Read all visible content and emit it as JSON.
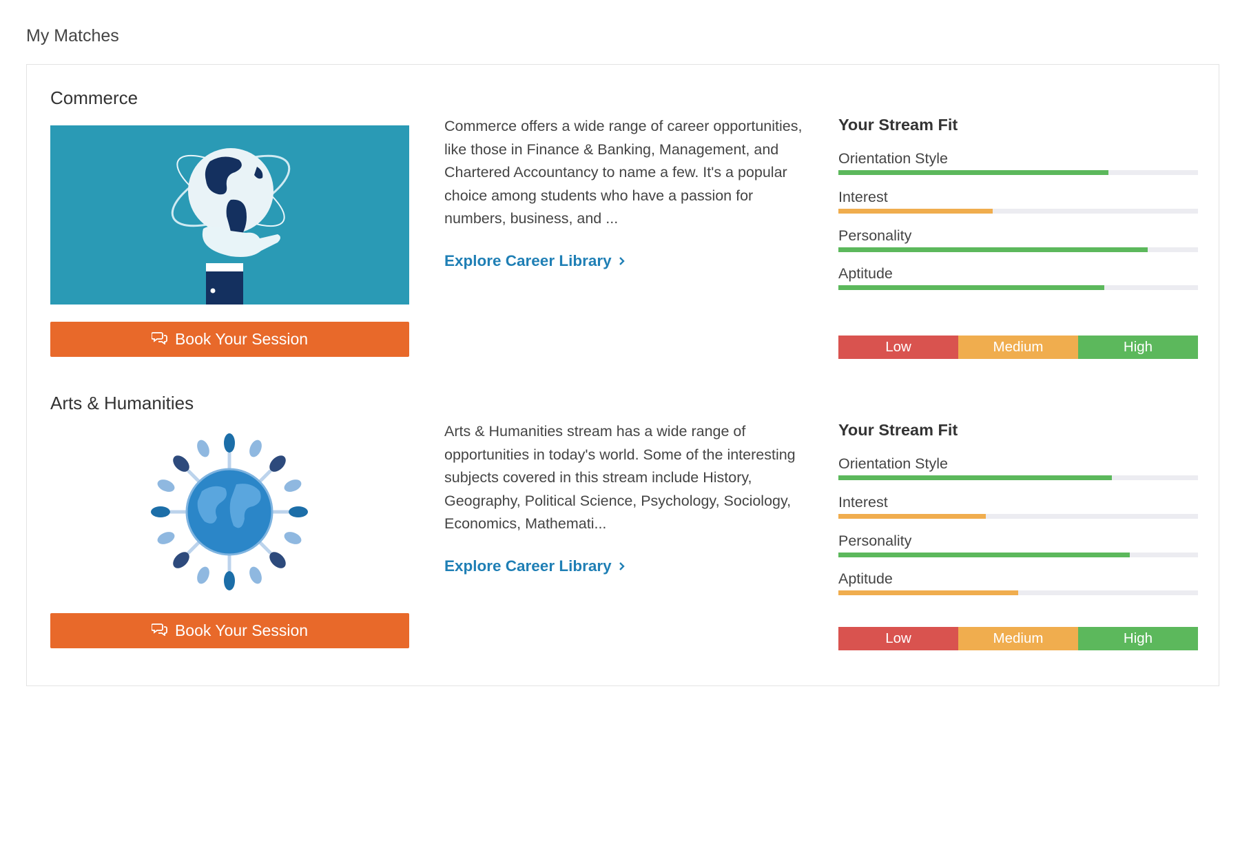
{
  "page_title": "My Matches",
  "colors": {
    "accent_button": "#e8692a",
    "link": "#1f7fb5",
    "fit_high": "#5cb85c",
    "fit_medium": "#f0ad4e",
    "fit_low": "#d9534f"
  },
  "streams": [
    {
      "name": "Commerce",
      "image_icon": "globe-in-hand-illustration",
      "description": "Commerce offers a wide range of career opportunities, like those in Finance & Banking, Management, and Chartered Accountancy to name a few. It's a popular choice among students who have a passion for numbers, business, and ...",
      "explore_label": "Explore Career Library",
      "book_label": "Book Your Session",
      "fit_title": "Your Stream Fit",
      "fit": [
        {
          "label": "Orientation Style",
          "fraction": 0.75,
          "level": "high"
        },
        {
          "label": "Interest",
          "fraction": 0.43,
          "level": "medium"
        },
        {
          "label": "Personality",
          "fraction": 0.86,
          "level": "high"
        },
        {
          "label": "Aptitude",
          "fraction": 0.74,
          "level": "high"
        }
      ],
      "legend": [
        "Low",
        "Medium",
        "High"
      ]
    },
    {
      "name": "Arts & Humanities",
      "image_icon": "globe-with-hands-illustration",
      "description": "Arts & Humanities stream has a wide range of opportunities in today's world. Some of the interesting subjects covered in this stream include History, Geography, Political Science, Psychology, Sociology, Economics, Mathemati...",
      "explore_label": "Explore Career Library",
      "book_label": "Book Your Session",
      "fit_title": "Your Stream Fit",
      "fit": [
        {
          "label": "Orientation Style",
          "fraction": 0.76,
          "level": "high"
        },
        {
          "label": "Interest",
          "fraction": 0.41,
          "level": "medium"
        },
        {
          "label": "Personality",
          "fraction": 0.81,
          "level": "high"
        },
        {
          "label": "Aptitude",
          "fraction": 0.5,
          "level": "medium"
        }
      ],
      "legend": [
        "Low",
        "Medium",
        "High"
      ]
    }
  ]
}
